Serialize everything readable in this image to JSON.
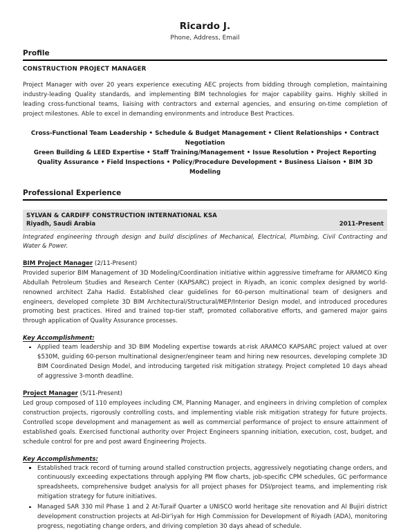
{
  "header": {
    "name": "Ricardo J.",
    "contact": "Phone, Address, Email"
  },
  "profile": {
    "heading": "Profile",
    "job_target": "CONSTRUCTION PROJECT MANAGER",
    "summary": "Project Manager with over 20 years experience executing AEC projects from bidding through completion, maintaining industry-leading Quality standards, and implementing BIM technologies for major capability gains. Highly skilled in leading cross-functional teams, liaising with contractors and external agencies, and ensuring on-time completion of project milestones. Able to excel in demanding environments and introduce Best Practices.",
    "competencies": [
      "Cross-Functional Team Leadership • Schedule & Budget Management • Client Relationships • Contract Negotiation",
      "Green Building & LEED Expertise • Staff Training/Management • Issue Resolution • Project Reporting",
      "Quality Assurance • Field Inspections • Policy/Procedure Development • Business Liaison • BIM 3D Modeling"
    ]
  },
  "experience": {
    "heading": "Professional Experience",
    "company": {
      "name": "SYLVAN & CARDIFF CONSTRUCTION INTERNATIONAL KSA",
      "location": "Riyadh, Saudi Arabia",
      "dates": "2011-Present",
      "description": "Integrated engineering through design and build disciplines of Mechanical, Electrical, Plumbing, Civil Contracting and Water & Power."
    },
    "roles": [
      {
        "title": "BIM Project Manager",
        "dates": "(2/11-Present)",
        "description": "Provided superior BIM Management of 3D Modeling/Coordination initiative within aggressive timeframe for ARAMCO King Abdullah Petroleum Studies and Research Center (KAPSARC) project in Riyadh, an iconic complex designed by world-renowned architect Zaha Hadid. Established clear guidelines for 60-person multinational team of designers and engineers, developed complete 3D BIM Architectural/Structural/MEP/Interior Design model, and introduced procedures promoting best practices. Hired and trained top-tier staff, promoted collaborative efforts, and garnered major gains through application of Quality Assurance processes.",
        "accomplishments_label": "Key Accomplishment:",
        "accomplishments": [
          "Applied team leadership and 3D BIM Modeling expertise towards at-risk ARAMCO KAPSARC project valued at over $530M, guiding 60-person multinational designer/engineer team and hiring new resources, developing complete 3D BIM Coordinated Design Model, and introducing targeted risk mitigation strategy. Project completed 10 days ahead of aggressive 3-month deadline."
        ]
      },
      {
        "title": "Project Manager",
        "dates": "(5/11-Present)",
        "description": "Led group composed of 110 employees including CM, Planning Manager, and engineers in driving completion of complex construction projects, rigorously controlling costs, and implementing viable risk mitigation strategy for future projects. Controlled scope development and management as well as commercial performance of project to ensure attainment of established goals. Exercised functional authority over Project Engineers spanning initiation, execution, cost, budget, and schedule control for pre and post award Engineering Projects.",
        "accomplishments_label": "Key Accomplishments:",
        "accomplishments": [
          "Established track record of turning around stalled construction projects, aggressively negotiating change orders, and continuously exceeding expectations through applying PM flow charts, job-specific CPM schedules, GC performance spreadsheets, comprehensive budget analysis for all project phases for DSI/project teams, and implementing risk mitigation strategy for future initiatives.",
          "Managed SAR 330 mil Phase 1 and 2 At-Turaif Quarter a UNISCO world heritage site renovation and Al Bujiri district development construction projects at Ad-Dir'iyah for High Commission for Development of Riyadh (ADA), monitoring progress, negotiating change orders, and driving completion 30 days ahead of schedule."
        ]
      }
    ]
  }
}
